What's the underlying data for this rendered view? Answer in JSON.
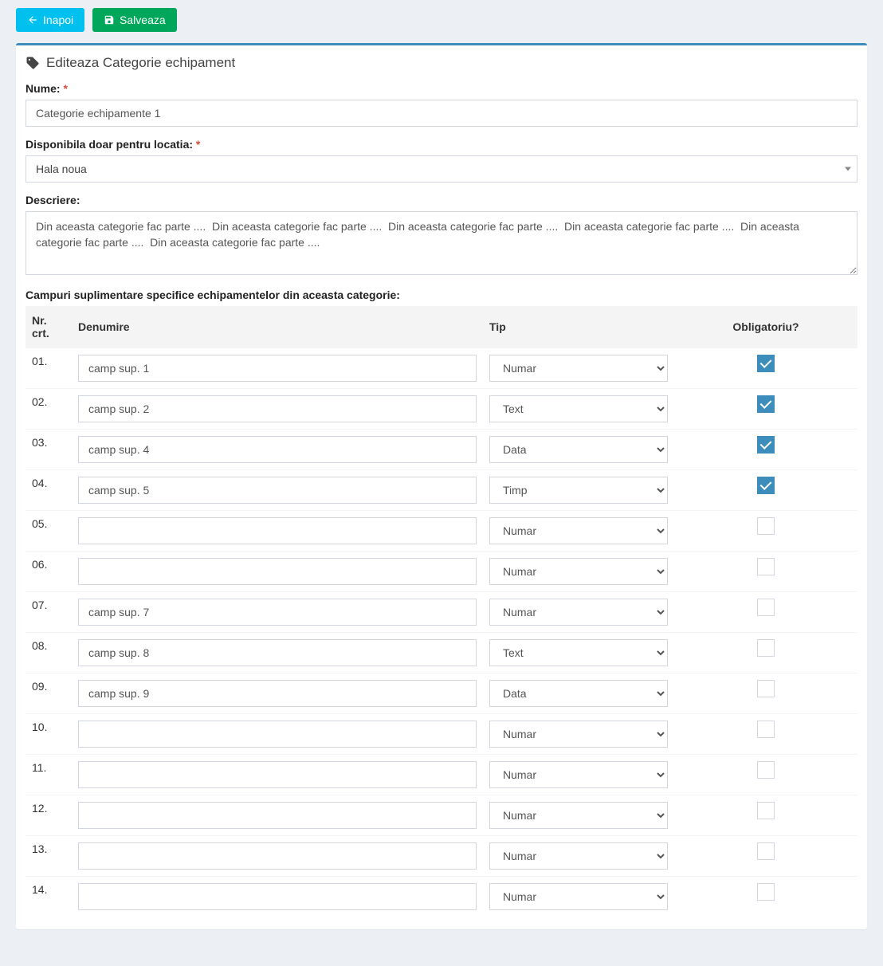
{
  "toolbar": {
    "back_label": "Inapoi",
    "save_label": "Salveaza"
  },
  "panel": {
    "heading": "Editeaza Categorie echipament"
  },
  "form": {
    "name_label": "Nume:",
    "name_value": "Categorie echipamente 1",
    "location_label": "Disponibila doar pentru locatia:",
    "location_value": "Hala noua",
    "description_label": "Descriere:",
    "description_value": "Din aceasta categorie fac parte ....  Din aceasta categorie fac parte ....  Din aceasta categorie fac parte ....  Din aceasta categorie fac parte ....  Din aceasta categorie fac parte ....  Din aceasta categorie fac parte ....",
    "extra_fields_label": "Campuri suplimentare specifice echipamentelor din aceasta categorie:"
  },
  "table": {
    "headers": {
      "nr": "Nr. crt.",
      "denumire": "Denumire",
      "tip": "Tip",
      "obligatoriu": "Obligatoriu?"
    },
    "tip_options": [
      "Numar",
      "Text",
      "Data",
      "Timp"
    ],
    "rows": [
      {
        "nr": "01.",
        "denumire": "camp sup. 1",
        "tip": "Numar",
        "obligatoriu": true
      },
      {
        "nr": "02.",
        "denumire": "camp sup. 2",
        "tip": "Text",
        "obligatoriu": true
      },
      {
        "nr": "03.",
        "denumire": "camp sup. 4",
        "tip": "Data",
        "obligatoriu": true
      },
      {
        "nr": "04.",
        "denumire": "camp sup. 5",
        "tip": "Timp",
        "obligatoriu": true
      },
      {
        "nr": "05.",
        "denumire": "",
        "tip": "Numar",
        "obligatoriu": false
      },
      {
        "nr": "06.",
        "denumire": "",
        "tip": "Numar",
        "obligatoriu": false
      },
      {
        "nr": "07.",
        "denumire": "camp sup. 7",
        "tip": "Numar",
        "obligatoriu": false
      },
      {
        "nr": "08.",
        "denumire": "camp sup. 8",
        "tip": "Text",
        "obligatoriu": false
      },
      {
        "nr": "09.",
        "denumire": "camp sup. 9",
        "tip": "Data",
        "obligatoriu": false
      },
      {
        "nr": "10.",
        "denumire": "",
        "tip": "Numar",
        "obligatoriu": false
      },
      {
        "nr": "11.",
        "denumire": "",
        "tip": "Numar",
        "obligatoriu": false
      },
      {
        "nr": "12.",
        "denumire": "",
        "tip": "Numar",
        "obligatoriu": false
      },
      {
        "nr": "13.",
        "denumire": "",
        "tip": "Numar",
        "obligatoriu": false
      },
      {
        "nr": "14.",
        "denumire": "",
        "tip": "Numar",
        "obligatoriu": false
      }
    ]
  }
}
